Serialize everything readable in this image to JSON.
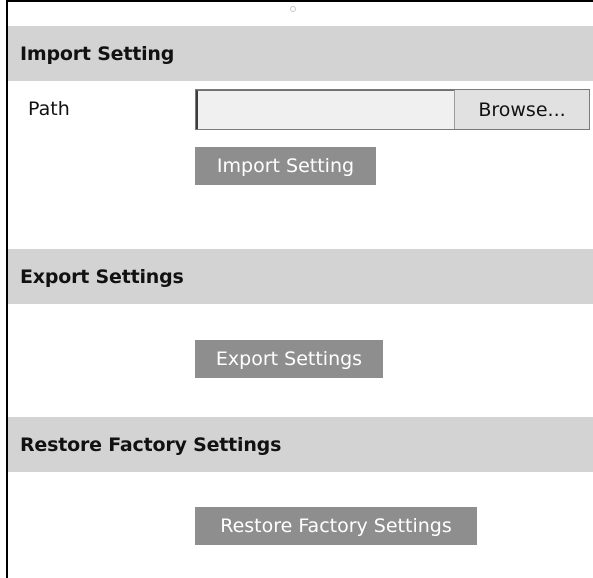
{
  "import": {
    "header": "Import Setting",
    "path_label": "Path",
    "path_value": "",
    "browse_label": "Browse...",
    "button_label": "Import Setting"
  },
  "export": {
    "header": "Export Settings",
    "button_label": "Export Settings"
  },
  "restore": {
    "header": "Restore Factory Settings",
    "button_label": "Restore Factory Settings"
  },
  "colors": {
    "header_bg": "#d3d3d3",
    "button_bg": "#8e8e8e",
    "button_text": "#ffffff",
    "input_bg": "#f0f0f0"
  }
}
